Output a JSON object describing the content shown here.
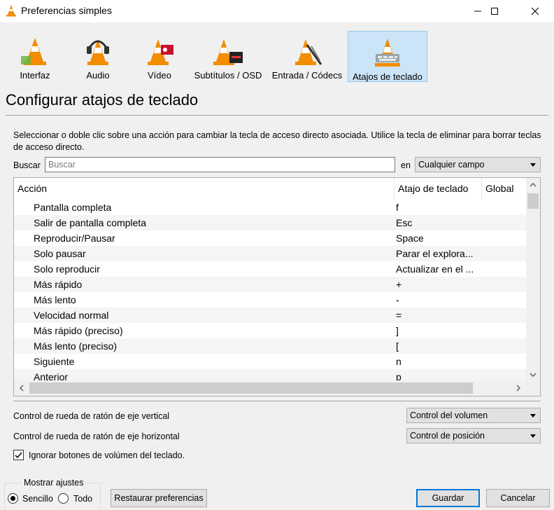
{
  "window": {
    "title": "Preferencias simples",
    "controls": {
      "minimize": "minimize-icon",
      "maximize": "maximize-icon",
      "close": "close-icon"
    }
  },
  "categories": [
    {
      "label": "Interfaz",
      "icon": "interface-cone-icon",
      "selected": false
    },
    {
      "label": "Audio",
      "icon": "headphones-cone-icon",
      "selected": false
    },
    {
      "label": "Vídeo",
      "icon": "video-cone-icon",
      "selected": false
    },
    {
      "label": "Subtítulos / OSD",
      "icon": "subtitles-cone-icon",
      "selected": false
    },
    {
      "label": "Entrada / Códecs",
      "icon": "input-cone-icon",
      "selected": false
    },
    {
      "label": "Atajos de teclado",
      "icon": "hotkeys-cone-icon",
      "selected": true
    }
  ],
  "page": {
    "title": "Configurar atajos de teclado",
    "description": "Seleccionar o doble clic sobre una acción para cambiar la tecla de acceso directo asociada. Utilice la tecla de eliminar para borrar teclas de acceso directo."
  },
  "search": {
    "label": "Buscar",
    "placeholder": "Buscar",
    "value": "",
    "in_label": "en",
    "field_value": "Cualquier campo"
  },
  "table": {
    "columns": [
      "Acción",
      "Atajo de teclado",
      "Global"
    ],
    "rows": [
      {
        "action": "Pantalla completa",
        "hotkey": "f"
      },
      {
        "action": "Salir de pantalla completa",
        "hotkey": "Esc"
      },
      {
        "action": "Reproducir/Pausar",
        "hotkey": "Space"
      },
      {
        "action": "Solo pausar",
        "hotkey": "Parar el explora..."
      },
      {
        "action": "Solo reproducir",
        "hotkey": "Actualizar en el ..."
      },
      {
        "action": "Más rápido",
        "hotkey": "+"
      },
      {
        "action": "Más lento",
        "hotkey": "-"
      },
      {
        "action": "Velocidad normal",
        "hotkey": "="
      },
      {
        "action": "Más rápido (preciso)",
        "hotkey": "]"
      },
      {
        "action": "Más lento (preciso)",
        "hotkey": "["
      },
      {
        "action": "Siguiente",
        "hotkey": "n"
      },
      {
        "action": "Anterior",
        "hotkey": "p"
      }
    ]
  },
  "wheel": {
    "vertical_label": "Control de rueda de ratón de eje vertical",
    "vertical_value": "Control del volumen",
    "horizontal_label": "Control de rueda de ratón de eje horizontal",
    "horizontal_value": "Control de posición"
  },
  "ignore_volume": {
    "label": "Ignorar botones de volúmen del teclado.",
    "checked": true
  },
  "show_settings": {
    "legend": "Mostrar ajustes",
    "simple": "Sencillo",
    "all": "Todo",
    "selected": "Sencillo"
  },
  "buttons": {
    "reset": "Restaurar preferencias",
    "save": "Guardar",
    "cancel": "Cancelar"
  },
  "colors": {
    "selected_bg": "#cce4f7",
    "selected_border": "#99c9ef",
    "default_button_border": "#0078d7",
    "cone_orange": "#f28c00"
  }
}
